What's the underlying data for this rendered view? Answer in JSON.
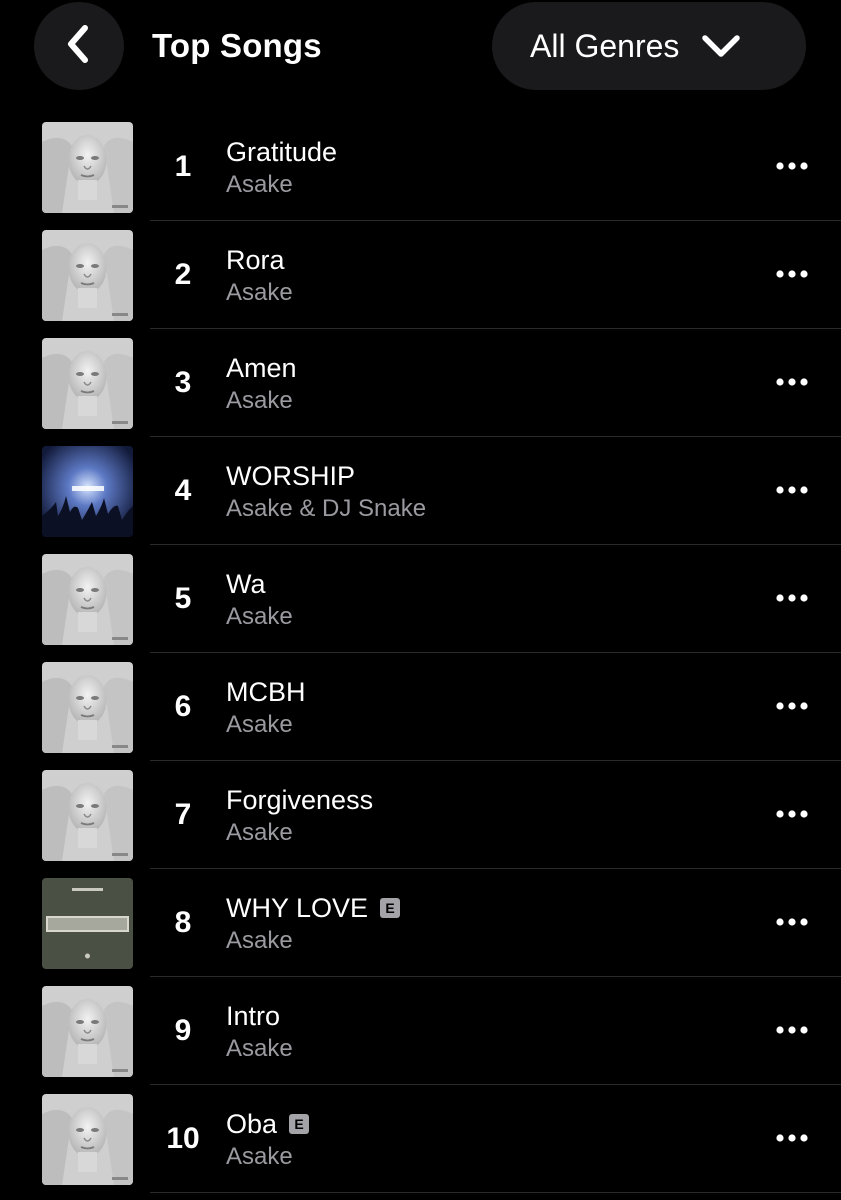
{
  "header": {
    "title": "Top Songs",
    "back_icon": "chevron-left-icon",
    "genre_label": "All Genres",
    "genre_icon": "chevron-down-icon"
  },
  "colors": {
    "background": "#000000",
    "button_bg": "#1a1a1c",
    "secondary_text": "#9a9aa0",
    "divider": "#2a2a2c"
  },
  "songs": [
    {
      "rank": "1",
      "title": "Gratitude",
      "artist": "Asake",
      "explicit": false,
      "cover": "lungu-boy-cover"
    },
    {
      "rank": "2",
      "title": "Rora",
      "artist": "Asake",
      "explicit": false,
      "cover": "lungu-boy-cover"
    },
    {
      "rank": "3",
      "title": "Amen",
      "artist": "Asake",
      "explicit": false,
      "cover": "lungu-boy-cover"
    },
    {
      "rank": "4",
      "title": "WORSHIP",
      "artist": "Asake & DJ Snake",
      "explicit": false,
      "cover": "worship-cover"
    },
    {
      "rank": "5",
      "title": "Wa",
      "artist": "Asake",
      "explicit": false,
      "cover": "lungu-boy-cover"
    },
    {
      "rank": "6",
      "title": "MCBH",
      "artist": "Asake",
      "explicit": false,
      "cover": "lungu-boy-cover"
    },
    {
      "rank": "7",
      "title": "Forgiveness",
      "artist": "Asake",
      "explicit": false,
      "cover": "lungu-boy-cover"
    },
    {
      "rank": "8",
      "title": "WHY LOVE",
      "artist": "Asake",
      "explicit": true,
      "explicit_label": "E",
      "cover": "why-love-cover"
    },
    {
      "rank": "9",
      "title": "Intro",
      "artist": "Asake",
      "explicit": false,
      "cover": "lungu-boy-cover"
    },
    {
      "rank": "10",
      "title": "Oba",
      "artist": "Asake",
      "explicit": true,
      "explicit_label": "E",
      "cover": "lungu-boy-cover"
    }
  ]
}
